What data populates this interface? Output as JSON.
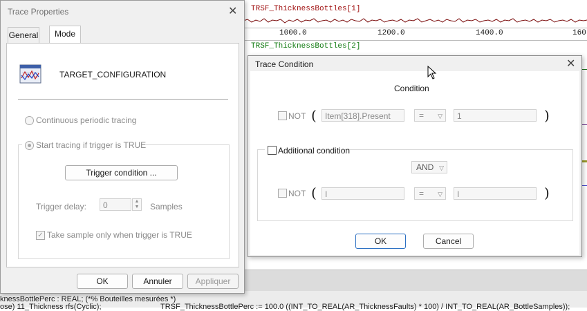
{
  "background": {
    "trace1_title": "TRSF_ThicknessBottles[1]",
    "trace2_title": "TRSF_ThicknessBottles[2]",
    "axis_ticks": [
      "1000.0",
      "1200.0",
      "1400.0",
      "160"
    ],
    "code_line1": "knessBottlePerc : REAL; (*% Bouteilles mesurées *)",
    "code_line2": "ose) 11_Thickness rfs(Cyclic);",
    "code_line3": "TRSF_ThicknessBottlePerc := 100.0 ((INT_TO_REAL(AR_ThicknessFaults) * 100) / INT_TO_REAL(AR_BottleSamples));"
  },
  "trace_properties": {
    "title": "Trace Properties",
    "tabs": [
      "General",
      "Mode"
    ],
    "active_tab": "Mode",
    "config_name": "TARGET_CONFIGURATION",
    "radio_continuous": "Continuous periodic tracing",
    "radio_trigger": "Start tracing if trigger is TRUE",
    "trigger_condition_button": "Trigger condition ...",
    "trigger_delay_label": "Trigger delay:",
    "trigger_delay_value": "0",
    "samples_label": "Samples",
    "take_sample_label": "Take sample only when trigger is TRUE",
    "ok_button": "OK",
    "cancel_button": "Annuler",
    "apply_button": "Appliquer"
  },
  "trace_condition": {
    "title": "Trace Condition",
    "condition_heading": "Condition",
    "not_label": "NOT",
    "open_paren": "(",
    "close_paren": ")",
    "item1_value": "Item[318].Present",
    "operator1": "=",
    "value1": "1",
    "additional_condition_label": "Additional condition",
    "logic_operator": "AND",
    "item2_value": "I",
    "operator2": "=",
    "value2": "I",
    "ok_button": "OK",
    "cancel_button": "Cancel"
  },
  "colors": {
    "trace_red": "#a01010",
    "trace_green": "#107a10",
    "primary_border": "#2b6fc2"
  }
}
